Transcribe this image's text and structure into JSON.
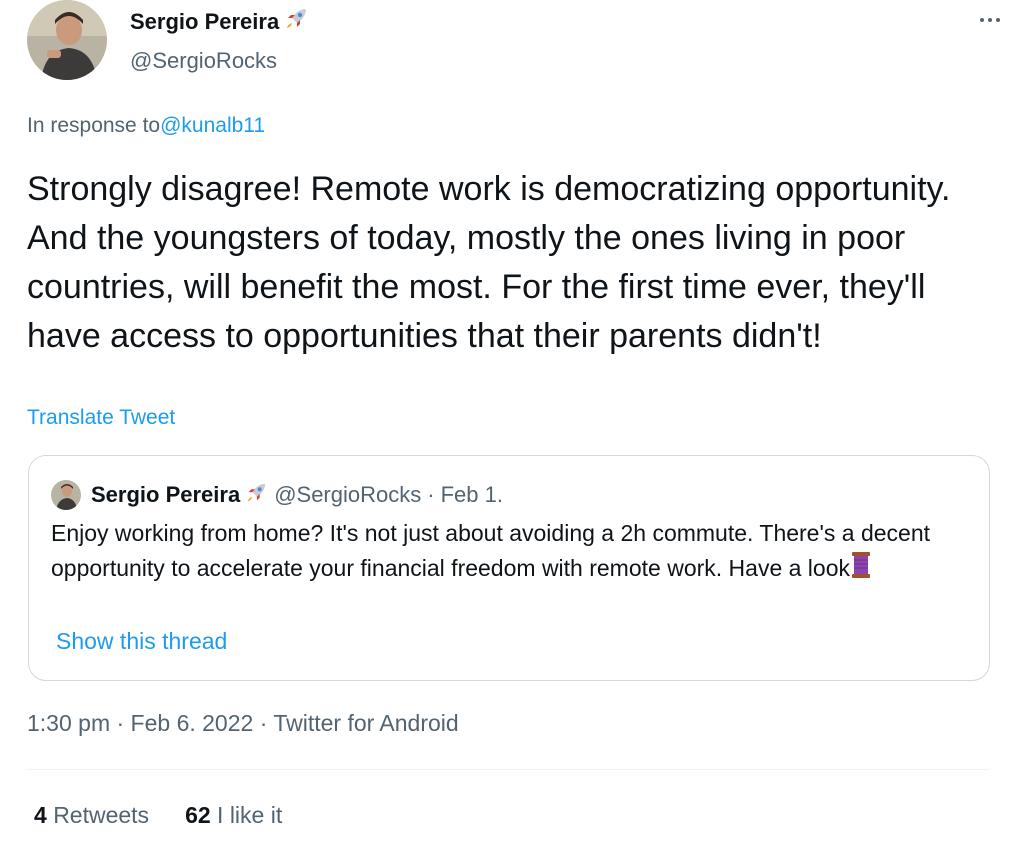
{
  "tweet": {
    "author": {
      "name": "Sergio Pereira",
      "name_emoji": "rocket-icon",
      "handle": "@SergioRocks"
    },
    "in_response_label": "In response to",
    "in_response_handle": "@kunalb11",
    "text": "Strongly disagree!  Remote work is democratizing opportunity. And the youngsters of today, mostly the ones living in poor countries, will benefit the most.  For the first time ever, they'll have access to opportunities that their parents didn't!",
    "translate_label": "Translate Tweet",
    "quoted": {
      "name": "Sergio Pereira",
      "handle": "@SergioRocks",
      "separator": "·",
      "date": "Feb 1.",
      "text": "Enjoy working from home?  It's not just about avoiding a 2h commute.  There's a decent opportunity to accelerate your financial freedom with remote work.  Have a look",
      "text_emoji": "thread-icon",
      "show_thread_label": "Show this thread"
    },
    "meta": "1:30 pm · Feb 6. 2022 · Twitter for Android",
    "stats": {
      "retweets_count": "4",
      "retweets_label": "Retweets",
      "likes_count": "62",
      "likes_label": "I like it"
    }
  },
  "colors": {
    "link": "#1d9bf0",
    "secondary": "#536471",
    "primary": "#0f1419",
    "border": "#cfd9de"
  }
}
